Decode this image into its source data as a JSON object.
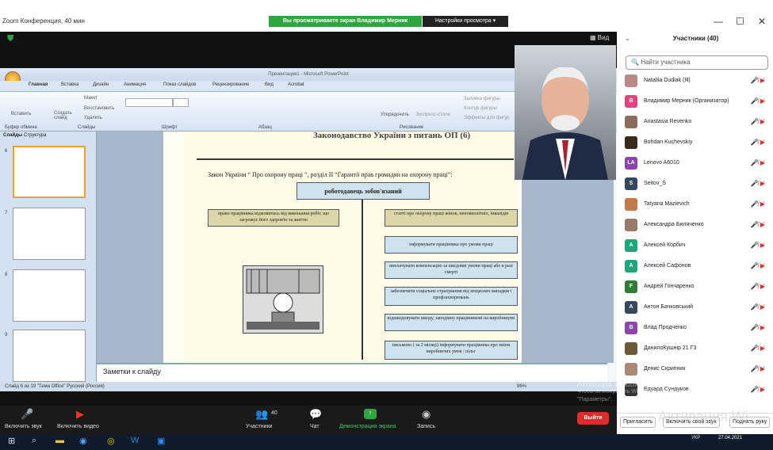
{
  "window": {
    "title": "Zoom Конференция, 40 мин",
    "banner": "Вы просматриваете экран Владимир Мерник",
    "view_settings": "Настройки просмотра ▾",
    "view_btn": "Вид"
  },
  "ppt": {
    "title": "Презентация1 - Microsoft PowerPoint",
    "tabs": [
      "Главная",
      "Вставка",
      "Дизайн",
      "Анимация",
      "Показ слайдов",
      "Рецензирование",
      "Вид",
      "Acrobat"
    ],
    "groups": [
      "Буфер обмена",
      "Слайды",
      "Шрифт",
      "Абзац",
      "Рисование"
    ],
    "ribbon": {
      "paste": "Вставить",
      "create": "Создать слайд",
      "layout": "Макет",
      "restore": "Восстановить",
      "delete": "Удалить",
      "arrange": "Упорядочить",
      "express": "Экспресс-стили",
      "fill": "Заливка фигуры",
      "outline": "Контур фигуры",
      "effects": "Эффекты для фигур"
    },
    "side_tabs": [
      "Слайды",
      "Структура"
    ],
    "slide_numbers": [
      "6",
      "7",
      "8",
      "9"
    ],
    "slide_heading": "Законодавство України з питань ОП (6)",
    "slide_intro": "Закон України “ Про охорону праці ”, розділ ІІ “Гарантії прав громадян на охорону праці”:",
    "center_box": "роботодавець зобов'язаний",
    "left_box": "право працівника відмовитись від виконання робіт, що загрожує його здоров'ю та життю",
    "right_boxes": [
      "статті про охорону праці жінок, неповнолітніх, інвалідів",
      "інформувати працівника про умови праці",
      "виплачувати компенсацію за шкідливі умови праці або в разі смерті",
      "забезпечити соціальне страхування від нещасних випадків і профзахворювань",
      "відшкодовувати шкоду, заподіяну працівникові на виробництві",
      "письмово ( за 2 місяці) інформувати працівника про зміни виробничих умов / пільг"
    ],
    "notes": "Заметки к слайду",
    "status": "Слайд 6 из 19    \"Тема Office\"    Русский (Россия)",
    "zoom": "86%"
  },
  "toolbar": {
    "mute": "Включить звук",
    "video": "Включить видео",
    "participants": "Участники",
    "participants_count": "40",
    "chat": "Чат",
    "share": "Демонстрация экрана",
    "record": "Запись",
    "exit": "Выйти"
  },
  "panel": {
    "title": "Участники (40)",
    "search_placeholder": "Найти участника",
    "participants": [
      {
        "name": "Nataliia Dudiak (Я)",
        "initial": "",
        "color": "#b88"
      },
      {
        "name": "Владимир Мерник (Организатор)",
        "initial": "B",
        "color": "#e0457b"
      },
      {
        "name": "Anastasia Revenko",
        "initial": "",
        "color": "#8a6d5a"
      },
      {
        "name": "Bohdan Kuchevskiy",
        "initial": "",
        "color": "#3a2a1a"
      },
      {
        "name": "Lenovo A6010",
        "initial": "LA",
        "color": "#8e44ad"
      },
      {
        "name": "Seitov_S",
        "initial": "S",
        "color": "#34495e"
      },
      {
        "name": "Tatyana Mazievich",
        "initial": "",
        "color": "#c47a4a"
      },
      {
        "name": "Александра Биляченко",
        "initial": "",
        "color": "#9a7a6a"
      },
      {
        "name": "Алексей Корбич",
        "initial": "A",
        "color": "#1fa67a"
      },
      {
        "name": "Алексей Сафонов",
        "initial": "A",
        "color": "#1fa67a"
      },
      {
        "name": "Андрей Гончаренко",
        "initial": "F",
        "color": "#2e7d32"
      },
      {
        "name": "Антон Бачковський",
        "initial": "A",
        "color": "#34495e"
      },
      {
        "name": "Влад Продченко",
        "initial": "B",
        "color": "#8e44ad"
      },
      {
        "name": "ДанилоКушнір 21 Г3",
        "initial": "",
        "color": "#6a5a3a"
      },
      {
        "name": "Денис Скрипник",
        "initial": "",
        "color": "#aa8877"
      },
      {
        "name": "Едуард Сундуков",
        "initial": "",
        "color": "#333"
      }
    ],
    "invite": "Пригласить",
    "unmute_all": "Включить свой звук",
    "raise": "Поднять руку"
  },
  "watermark": {
    "line1": "Активация Windows",
    "line2": "Чтобы активировать Windows, перейдите в раздел",
    "line3": "\"Параметры\".",
    "line4": "Активация Wi"
  },
  "taskbar": {
    "lang": "УКР",
    "time": "",
    "date": "27.04.2021"
  }
}
